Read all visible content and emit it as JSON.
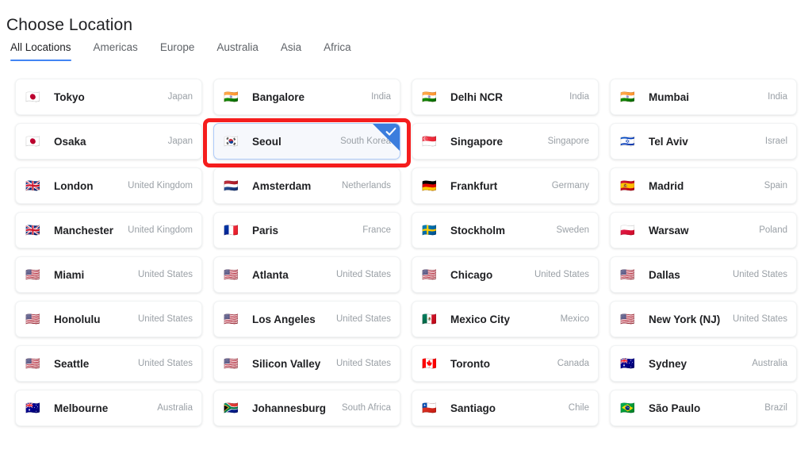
{
  "header": {
    "title": "Choose Location"
  },
  "tabs": [
    {
      "label": "All Locations",
      "active": true
    },
    {
      "label": "Americas",
      "active": false
    },
    {
      "label": "Europe",
      "active": false
    },
    {
      "label": "Australia",
      "active": false
    },
    {
      "label": "Asia",
      "active": false
    },
    {
      "label": "Africa",
      "active": false
    }
  ],
  "selection": {
    "selected_city": "Seoul",
    "check_icon": "check-icon",
    "corner_color": "#3b7ddd",
    "highlight_color": "#f51d1d",
    "selected_bg": "#f6f8fc",
    "selected_border": "#aecbfa"
  },
  "colors": {
    "accent": "#4285f4",
    "title_text": "#202124",
    "muted_text": "#9aa0a6",
    "tab_inactive": "#5f6368"
  },
  "locations": [
    {
      "flag": "🇯🇵",
      "flag_name": "flag-japan",
      "city": "Tokyo",
      "country": "Japan",
      "selected": false
    },
    {
      "flag": "🇮🇳",
      "flag_name": "flag-india",
      "city": "Bangalore",
      "country": "India",
      "selected": false
    },
    {
      "flag": "🇮🇳",
      "flag_name": "flag-india",
      "city": "Delhi NCR",
      "country": "India",
      "selected": false
    },
    {
      "flag": "🇮🇳",
      "flag_name": "flag-india",
      "city": "Mumbai",
      "country": "India",
      "selected": false
    },
    {
      "flag": "🇯🇵",
      "flag_name": "flag-japan",
      "city": "Osaka",
      "country": "Japan",
      "selected": false
    },
    {
      "flag": "🇰🇷",
      "flag_name": "flag-south-korea",
      "city": "Seoul",
      "country": "South Korea",
      "selected": true
    },
    {
      "flag": "🇸🇬",
      "flag_name": "flag-singapore",
      "city": "Singapore",
      "country": "Singapore",
      "selected": false
    },
    {
      "flag": "🇮🇱",
      "flag_name": "flag-israel",
      "city": "Tel Aviv",
      "country": "Israel",
      "selected": false
    },
    {
      "flag": "🇬🇧",
      "flag_name": "flag-united-kingdom",
      "city": "London",
      "country": "United Kingdom",
      "selected": false
    },
    {
      "flag": "🇳🇱",
      "flag_name": "flag-netherlands",
      "city": "Amsterdam",
      "country": "Netherlands",
      "selected": false
    },
    {
      "flag": "🇩🇪",
      "flag_name": "flag-germany",
      "city": "Frankfurt",
      "country": "Germany",
      "selected": false
    },
    {
      "flag": "🇪🇸",
      "flag_name": "flag-spain",
      "city": "Madrid",
      "country": "Spain",
      "selected": false
    },
    {
      "flag": "🇬🇧",
      "flag_name": "flag-united-kingdom",
      "city": "Manchester",
      "country": "United Kingdom",
      "selected": false
    },
    {
      "flag": "🇫🇷",
      "flag_name": "flag-france",
      "city": "Paris",
      "country": "France",
      "selected": false
    },
    {
      "flag": "🇸🇪",
      "flag_name": "flag-sweden",
      "city": "Stockholm",
      "country": "Sweden",
      "selected": false
    },
    {
      "flag": "🇵🇱",
      "flag_name": "flag-poland",
      "city": "Warsaw",
      "country": "Poland",
      "selected": false
    },
    {
      "flag": "🇺🇸",
      "flag_name": "flag-united-states",
      "city": "Miami",
      "country": "United States",
      "selected": false
    },
    {
      "flag": "🇺🇸",
      "flag_name": "flag-united-states",
      "city": "Atlanta",
      "country": "United States",
      "selected": false
    },
    {
      "flag": "🇺🇸",
      "flag_name": "flag-united-states",
      "city": "Chicago",
      "country": "United States",
      "selected": false
    },
    {
      "flag": "🇺🇸",
      "flag_name": "flag-united-states",
      "city": "Dallas",
      "country": "United States",
      "selected": false
    },
    {
      "flag": "🇺🇸",
      "flag_name": "flag-united-states",
      "city": "Honolulu",
      "country": "United States",
      "selected": false
    },
    {
      "flag": "🇺🇸",
      "flag_name": "flag-united-states",
      "city": "Los Angeles",
      "country": "United States",
      "selected": false
    },
    {
      "flag": "🇲🇽",
      "flag_name": "flag-mexico",
      "city": "Mexico City",
      "country": "Mexico",
      "selected": false
    },
    {
      "flag": "🇺🇸",
      "flag_name": "flag-united-states",
      "city": "New York (NJ)",
      "country": "United States",
      "selected": false
    },
    {
      "flag": "🇺🇸",
      "flag_name": "flag-united-states",
      "city": "Seattle",
      "country": "United States",
      "selected": false
    },
    {
      "flag": "🇺🇸",
      "flag_name": "flag-united-states",
      "city": "Silicon Valley",
      "country": "United States",
      "selected": false
    },
    {
      "flag": "🇨🇦",
      "flag_name": "flag-canada",
      "city": "Toronto",
      "country": "Canada",
      "selected": false
    },
    {
      "flag": "🇦🇺",
      "flag_name": "flag-australia",
      "city": "Sydney",
      "country": "Australia",
      "selected": false
    },
    {
      "flag": "🇦🇺",
      "flag_name": "flag-australia",
      "city": "Melbourne",
      "country": "Australia",
      "selected": false
    },
    {
      "flag": "🇿🇦",
      "flag_name": "flag-south-africa",
      "city": "Johannesburg",
      "country": "South Africa",
      "selected": false
    },
    {
      "flag": "🇨🇱",
      "flag_name": "flag-chile",
      "city": "Santiago",
      "country": "Chile",
      "selected": false
    },
    {
      "flag": "🇧🇷",
      "flag_name": "flag-brazil",
      "city": "São Paulo",
      "country": "Brazil",
      "selected": false
    }
  ]
}
